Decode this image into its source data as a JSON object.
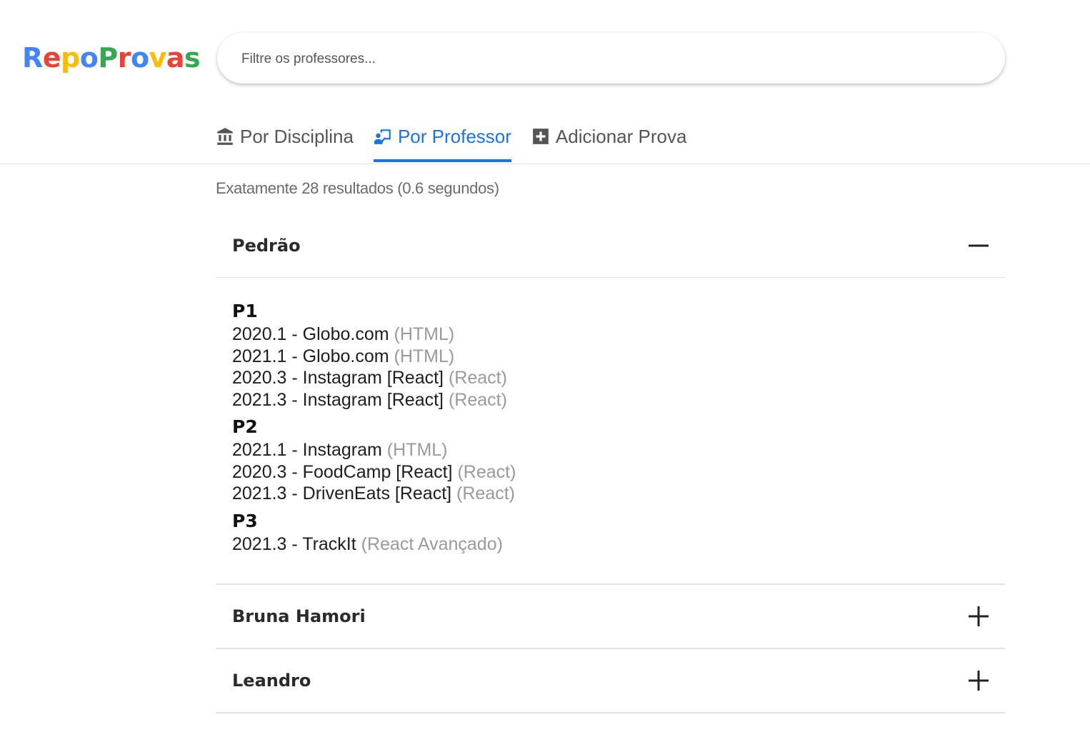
{
  "app": {
    "logo_letters": [
      {
        "char": "R",
        "color": "#4285F4"
      },
      {
        "char": "e",
        "color": "#EA4335"
      },
      {
        "char": "p",
        "color": "#FBBC05"
      },
      {
        "char": "o",
        "color": "#4285F4"
      },
      {
        "char": "P",
        "color": "#34A853"
      },
      {
        "char": "r",
        "color": "#EA4335"
      },
      {
        "char": "o",
        "color": "#4285F4"
      },
      {
        "char": "v",
        "color": "#FBBC05"
      },
      {
        "char": "a",
        "color": "#EA4335"
      },
      {
        "char": "s",
        "color": "#34A853"
      }
    ]
  },
  "search": {
    "placeholder": "Filtre os professores...",
    "value": ""
  },
  "tabs": [
    {
      "label": "Por Disciplina",
      "icon": "bank-icon",
      "active": false
    },
    {
      "label": "Por Professor",
      "icon": "teacher-icon",
      "active": true
    },
    {
      "label": "Adicionar Prova",
      "icon": "plus-box-icon",
      "active": false
    }
  ],
  "results_text": "Exatamente 28 resultados (0.6 segundos)",
  "colors": {
    "accent": "#1a73e8",
    "muted": "#9a9a9a"
  },
  "teachers": [
    {
      "name": "Pedrão",
      "expanded": true,
      "toggle_icon": "minus-icon",
      "categories": [
        {
          "title": "P1",
          "tests": [
            {
              "label": "2020.1 - Globo.com",
              "discipline": "(HTML)"
            },
            {
              "label": "2021.1 - Globo.com",
              "discipline": "(HTML)"
            },
            {
              "label": "2020.3 - Instagram [React]",
              "discipline": "(React)"
            },
            {
              "label": "2021.3 - Instagram [React]",
              "discipline": "(React)"
            }
          ]
        },
        {
          "title": "P2",
          "tests": [
            {
              "label": "2021.1 - Instagram",
              "discipline": "(HTML)"
            },
            {
              "label": "2020.3 - FoodCamp [React]",
              "discipline": "(React)"
            },
            {
              "label": "2021.3 - DrivenEats [React]",
              "discipline": "(React)"
            }
          ]
        },
        {
          "title": "P3",
          "tests": [
            {
              "label": "2021.3 - TrackIt",
              "discipline": "(React Avançado)"
            }
          ]
        }
      ]
    },
    {
      "name": "Bruna Hamori",
      "expanded": false,
      "toggle_icon": "plus-icon"
    },
    {
      "name": "Leandro",
      "expanded": false,
      "toggle_icon": "plus-icon"
    }
  ]
}
